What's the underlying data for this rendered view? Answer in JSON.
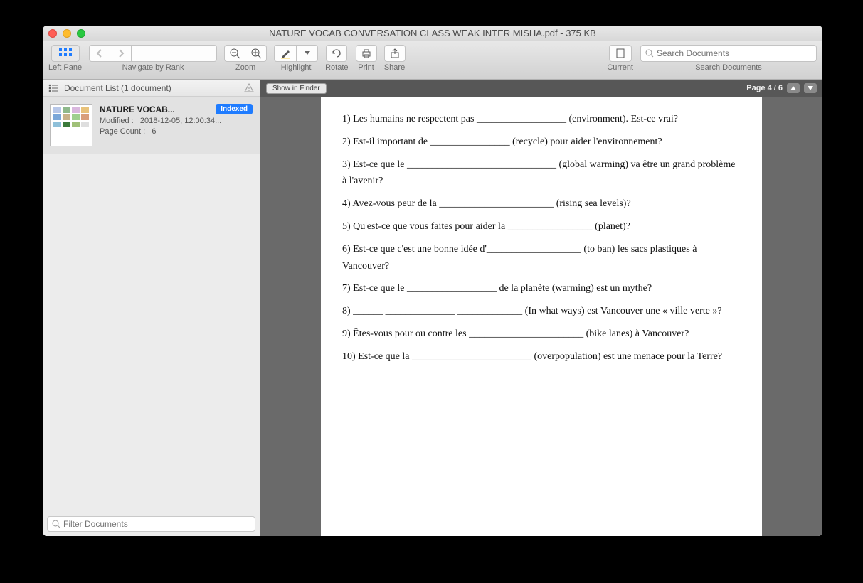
{
  "window": {
    "title": "NATURE VOCAB CONVERSATION CLASS WEAK INTER MISHA.pdf - 375 KB"
  },
  "toolbar": {
    "left_pane": "Left Pane",
    "navigate": "Navigate by Rank",
    "zoom": "Zoom",
    "highlight": "Highlight",
    "rotate": "Rotate",
    "print": "Print",
    "share": "Share",
    "current": "Current",
    "search_label": "Search Documents",
    "search_placeholder": "Search Documents"
  },
  "sidebar": {
    "header": "Document List (1 document)",
    "doc": {
      "title": "NATURE VOCAB...",
      "badge": "Indexed",
      "modified_label": "Modified :",
      "modified_value": "2018-12-05, 12:00:34...",
      "pagecount_label": "Page Count :",
      "pagecount_value": "6"
    },
    "filter_placeholder": "Filter Documents"
  },
  "viewer": {
    "show_in_finder": "Show in Finder",
    "page_indicator": "Page 4 / 6"
  },
  "document": {
    "lines": [
      "1) Les humains ne respectent pas __________________ (environment). Est-ce vrai?",
      "2) Est-il important de ________________ (recycle) pour aider l'environnement?",
      "3) Est-ce que le ______________________________ (global warming) va être un grand problème à l'avenir?",
      "4) Avez-vous peur de la _______________________ (rising sea levels)?",
      "5) Qu'est-ce que vous faites pour aider la _________________ (planet)?",
      "6) Est-ce que c'est une bonne idée d'___________________ (to ban) les sacs plastiques à Vancouver?",
      "7) Est-ce que le __________________ de la planète (warming) est un mythe?",
      "8) ______ ______________ _____________ (In what ways) est Vancouver une « ville verte »?",
      "9) Êtes-vous pour ou contre les _______________________ (bike lanes) à Vancouver?",
      "10) Est-ce que la ________________________ (overpopulation) est une menace pour la Terre?"
    ]
  }
}
